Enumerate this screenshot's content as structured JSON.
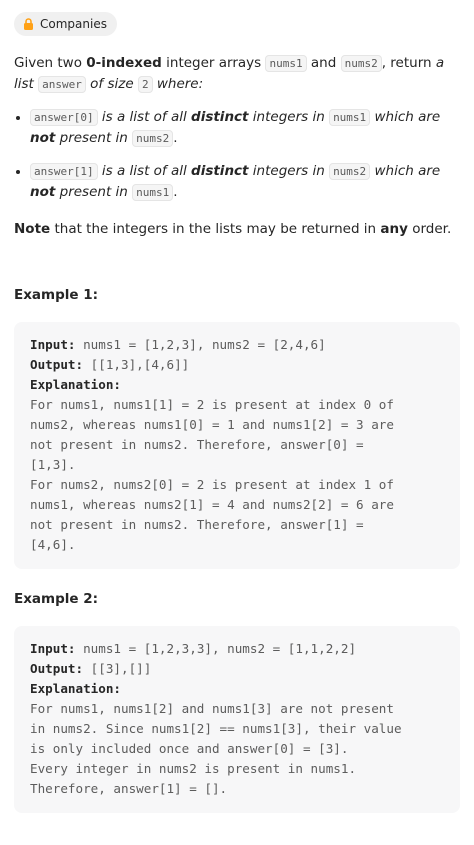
{
  "companies_label": "Companies",
  "intro": {
    "t1": "Given two ",
    "b1": "0-indexed",
    "t2": " integer arrays ",
    "c1": "nums1",
    "t3": " and ",
    "c2": "nums2",
    "t4": ", return ",
    "i1": "a list",
    "c3": "answer",
    "i2": " of size ",
    "c4": "2",
    "i3": " where:"
  },
  "bullets": [
    {
      "code": "answer[0]",
      "i1": " is a list of all ",
      "b1": "distinct",
      "i2": " integers in ",
      "code2": "nums1",
      "i3": " which are ",
      "b2": "not",
      "i4": " present in ",
      "code3": "nums2",
      "end": "."
    },
    {
      "code": "answer[1]",
      "i1": " is a list of all ",
      "b1": "distinct",
      "i2": " integers in ",
      "code2": "nums2",
      "i3": " which are ",
      "b2": "not",
      "i4": " present in ",
      "code3": "nums1",
      "end": "."
    }
  ],
  "note": {
    "b1": "Note",
    "t1": " that the integers in the lists may be returned in ",
    "b2": "any",
    "t2": " order."
  },
  "examples": [
    {
      "title": "Example 1:",
      "input_label": "Input:",
      "input": " nums1 = [1,2,3], nums2 = [2,4,6]",
      "output_label": "Output:",
      "output": " [[1,3],[4,6]]",
      "explanation_label": "Explanation:",
      "explanation": "For nums1, nums1[1] = 2 is present at index 0 of\nnums2, whereas nums1[0] = 1 and nums1[2] = 3 are\nnot present in nums2. Therefore, answer[0] =\n[1,3].\nFor nums2, nums2[0] = 2 is present at index 1 of\nnums1, whereas nums2[1] = 4 and nums2[2] = 6 are\nnot present in nums2. Therefore, answer[1] =\n[4,6]."
    },
    {
      "title": "Example 2:",
      "input_label": "Input:",
      "input": " nums1 = [1,2,3,3], nums2 = [1,1,2,2]",
      "output_label": "Output:",
      "output": " [[3],[]]",
      "explanation_label": "Explanation:",
      "explanation": "For nums1, nums1[2] and nums1[3] are not present\nin nums2. Since nums1[2] == nums1[3], their value\nis only included once and answer[0] = [3].\nEvery integer in nums2 is present in nums1.\nTherefore, answer[1] = []."
    }
  ],
  "colors": {
    "lock": "#ffa116",
    "text": "#262626",
    "code_bg": "#f5f5f5",
    "example_bg": "#f7f7f8"
  }
}
